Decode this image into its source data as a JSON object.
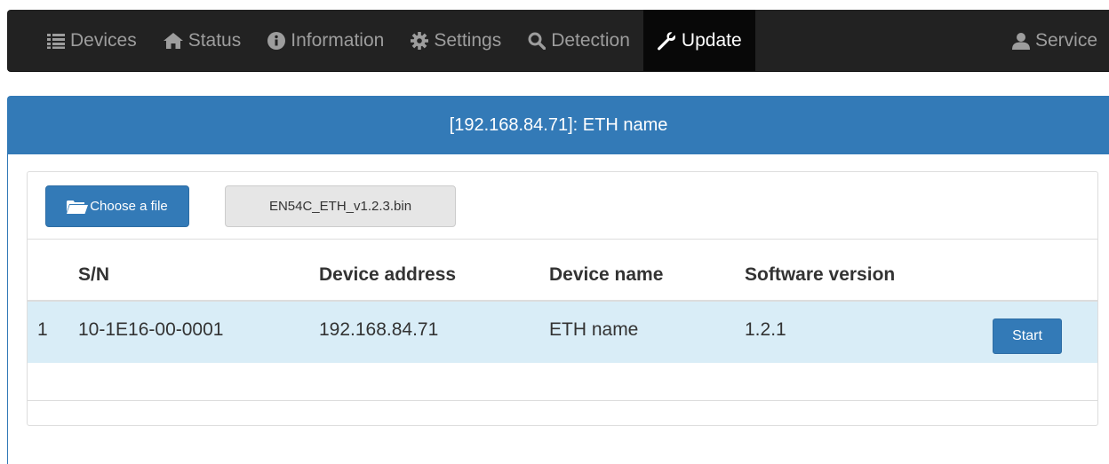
{
  "navbar": {
    "items": [
      {
        "label": "Devices",
        "icon": "list-icon",
        "active": false
      },
      {
        "label": "Status",
        "icon": "home-icon",
        "active": false
      },
      {
        "label": "Information",
        "icon": "info-icon",
        "active": false
      },
      {
        "label": "Settings",
        "icon": "gear-icon",
        "active": false
      },
      {
        "label": "Detection",
        "icon": "search-icon",
        "active": false
      },
      {
        "label": "Update",
        "icon": "wrench-icon",
        "active": true
      }
    ],
    "service": {
      "label": "Service",
      "icon": "user-icon"
    }
  },
  "panel": {
    "title": "[192.168.84.71]: ETH name"
  },
  "file": {
    "choose_label": "Choose a file",
    "choose_icon": "folder-open-icon",
    "selected_file": "EN54C_ETH_v1.2.3.bin"
  },
  "table": {
    "headers": [
      "S/N",
      "Device address",
      "Device name",
      "Software version"
    ],
    "rows": [
      {
        "index": "1",
        "sn": "10-1E16-00-0001",
        "address": "192.168.84.71",
        "name": "ETH name",
        "version": "1.2.1",
        "action_label": "Start"
      }
    ]
  },
  "colors": {
    "navbar_bg": "#222222",
    "navbar_active_bg": "#080808",
    "primary": "#337ab7",
    "row_highlight": "#d9edf7"
  }
}
